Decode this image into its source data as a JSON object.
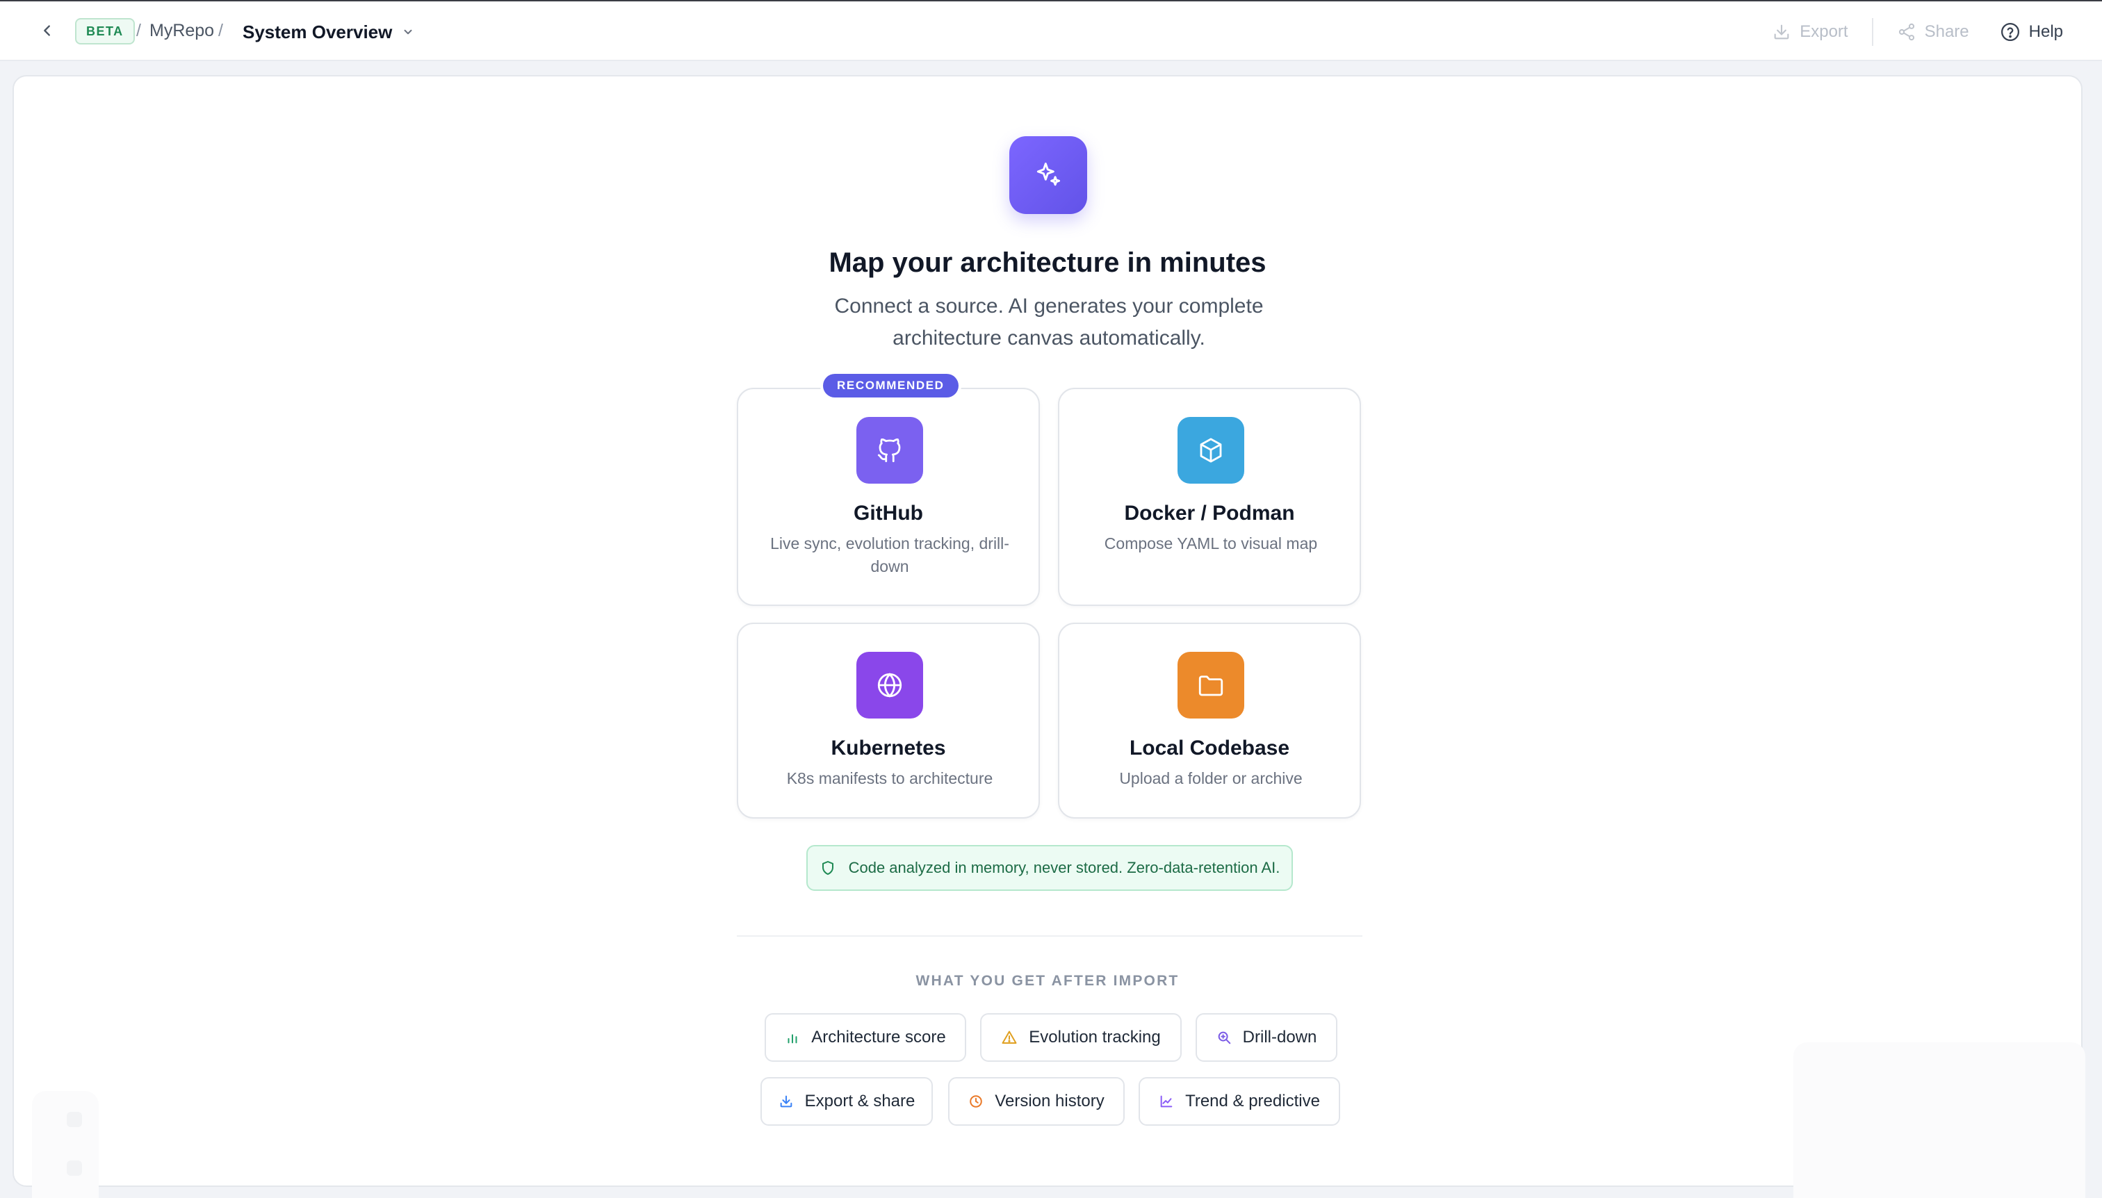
{
  "header": {
    "back_label": "",
    "beta": "BETA",
    "separator": "/",
    "repo": "MyRepo",
    "current_view": "System Overview",
    "actions": {
      "export": "Export",
      "share": "Share",
      "help": "Help"
    }
  },
  "hero": {
    "title": "Map your architecture in minutes",
    "subtitle": "Connect a source. AI generates your complete architecture canvas automatically."
  },
  "sources": {
    "recommended_badge": "RECOMMENDED",
    "github": {
      "title": "GitHub",
      "description": "Live sync, evolution tracking, drill-down",
      "icon": "github-icon"
    },
    "docker": {
      "title": "Docker / Podman",
      "description": "Compose YAML to visual map",
      "icon": "box-icon"
    },
    "kubernetes": {
      "title": "Kubernetes",
      "description": "K8s manifests to architecture",
      "icon": "globe-icon"
    },
    "local": {
      "title": "Local Codebase",
      "description": "Upload a folder or archive",
      "icon": "folder-icon"
    }
  },
  "privacy_note": "Code analyzed in memory, never stored. Zero-data-retention AI.",
  "features": {
    "heading": "WHAT YOU GET AFTER IMPORT",
    "items": [
      {
        "label": "Architecture score",
        "icon": "bar-chart-icon",
        "color": "#22a06b"
      },
      {
        "label": "Evolution tracking",
        "icon": "warning-triangle-icon",
        "color": "#e0a021"
      },
      {
        "label": "Drill-down",
        "icon": "zoom-in-icon",
        "color": "#7c5ce6"
      },
      {
        "label": "Export & share",
        "icon": "download-icon",
        "color": "#3b82f6"
      },
      {
        "label": "Version history",
        "icon": "clock-icon",
        "color": "#ea7a2a"
      },
      {
        "label": "Trend & predictive",
        "icon": "line-chart-icon",
        "color": "#8b5cf6"
      }
    ]
  },
  "colors": {
    "accent": "#6c5ce7",
    "github_bg": "#7b61f0",
    "docker_bg": "#3ba7df",
    "kubernetes_bg": "#8a47ea",
    "local_bg": "#ec8a2b",
    "success": "#1f8a54"
  }
}
